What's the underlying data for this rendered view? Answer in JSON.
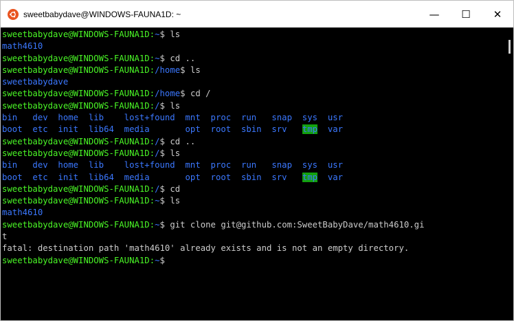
{
  "window": {
    "title": "sweetbabydave@WINDOWS-FAUNA1D: ~",
    "minimize_glyph": "—",
    "maximize_glyph": "☐",
    "close_glyph": "✕"
  },
  "colors": {
    "user_host": "#4af626",
    "path_dir": "#3b78ff",
    "text": "#cccccc",
    "highlight_bg": "#13a10e",
    "background": "#000000"
  },
  "terminal": {
    "lines": [
      {
        "segments": [
          {
            "text": "sweetbabydave@WINDOWS-FAUNA1D:",
            "style": "u"
          },
          {
            "text": "~",
            "style": "p"
          },
          {
            "text": "$ ls",
            "style": "t"
          }
        ]
      },
      {
        "segments": [
          {
            "text": "math4610",
            "style": "p"
          }
        ]
      },
      {
        "segments": [
          {
            "text": "sweetbabydave@WINDOWS-FAUNA1D:",
            "style": "u"
          },
          {
            "text": "~",
            "style": "p"
          },
          {
            "text": "$ cd ..",
            "style": "t"
          }
        ]
      },
      {
        "segments": [
          {
            "text": "sweetbabydave@WINDOWS-FAUNA1D:",
            "style": "u"
          },
          {
            "text": "/home",
            "style": "p"
          },
          {
            "text": "$ ls",
            "style": "t"
          }
        ]
      },
      {
        "segments": [
          {
            "text": "sweetbabydave",
            "style": "p"
          }
        ]
      },
      {
        "segments": [
          {
            "text": "sweetbabydave@WINDOWS-FAUNA1D:",
            "style": "u"
          },
          {
            "text": "/home",
            "style": "p"
          },
          {
            "text": "$ cd /",
            "style": "t"
          }
        ]
      },
      {
        "segments": [
          {
            "text": "sweetbabydave@WINDOWS-FAUNA1D:",
            "style": "u"
          },
          {
            "text": "/",
            "style": "p"
          },
          {
            "text": "$ ls",
            "style": "t"
          }
        ]
      },
      {
        "segments": [
          {
            "text": "bin   dev  home  lib    lost+found  mnt  proc  run   snap  sys  usr",
            "style": "p"
          }
        ]
      },
      {
        "segments": [
          {
            "text": "boot  etc  init  lib64  media       opt  root  sbin  srv   ",
            "style": "p"
          },
          {
            "text": "tmp",
            "style": "hl"
          },
          {
            "text": "  var",
            "style": "p"
          }
        ]
      },
      {
        "segments": [
          {
            "text": "sweetbabydave@WINDOWS-FAUNA1D:",
            "style": "u"
          },
          {
            "text": "/",
            "style": "p"
          },
          {
            "text": "$ cd ..",
            "style": "t"
          }
        ]
      },
      {
        "segments": [
          {
            "text": "sweetbabydave@WINDOWS-FAUNA1D:",
            "style": "u"
          },
          {
            "text": "/",
            "style": "p"
          },
          {
            "text": "$ ls",
            "style": "t"
          }
        ]
      },
      {
        "segments": [
          {
            "text": "bin   dev  home  lib    lost+found  mnt  proc  run   snap  sys  usr",
            "style": "p"
          }
        ]
      },
      {
        "segments": [
          {
            "text": "boot  etc  init  lib64  media       opt  root  sbin  srv   ",
            "style": "p"
          },
          {
            "text": "tmp",
            "style": "hl"
          },
          {
            "text": "  var",
            "style": "p"
          }
        ]
      },
      {
        "segments": [
          {
            "text": "sweetbabydave@WINDOWS-FAUNA1D:",
            "style": "u"
          },
          {
            "text": "/",
            "style": "p"
          },
          {
            "text": "$ cd",
            "style": "t"
          }
        ]
      },
      {
        "segments": [
          {
            "text": "sweetbabydave@WINDOWS-FAUNA1D:",
            "style": "u"
          },
          {
            "text": "~",
            "style": "p"
          },
          {
            "text": "$ ls",
            "style": "t"
          }
        ]
      },
      {
        "segments": [
          {
            "text": "math4610",
            "style": "p"
          }
        ]
      },
      {
        "segments": [
          {
            "text": "sweetbabydave@WINDOWS-FAUNA1D:",
            "style": "u"
          },
          {
            "text": "~",
            "style": "p"
          },
          {
            "text": "$ git clone git@github.com:SweetBabyDave/math4610.gi",
            "style": "t"
          }
        ]
      },
      {
        "segments": [
          {
            "text": "t",
            "style": "t"
          }
        ]
      },
      {
        "segments": [
          {
            "text": "fatal: destination path 'math4610' already exists and is not an empty directory.",
            "style": "t"
          }
        ]
      },
      {
        "segments": [
          {
            "text": "sweetbabydave@WINDOWS-FAUNA1D:",
            "style": "u"
          },
          {
            "text": "~",
            "style": "p"
          },
          {
            "text": "$",
            "style": "t"
          }
        ]
      }
    ]
  }
}
